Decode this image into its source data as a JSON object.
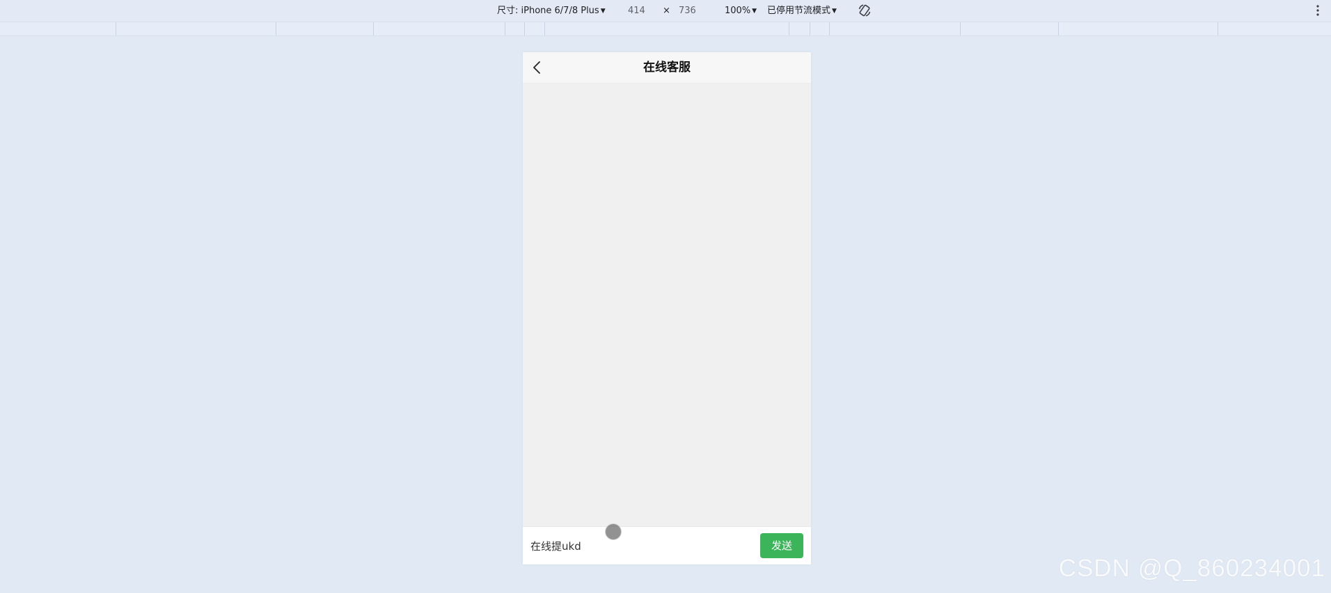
{
  "devtools": {
    "device_label": "尺寸: iPhone 6/7/8 Plus",
    "width": "414",
    "times": "×",
    "height": "736",
    "zoom": "100%",
    "throttle": "已停用节流模式",
    "rotate_icon": "rotate-icon",
    "more_icon": "more-vertical-icon"
  },
  "page": {
    "back_icon": "chevron-left-icon",
    "title": "在线客服"
  },
  "input": {
    "value": "在线提ukd"
  },
  "send_label": "发送",
  "watermark": "CSDN @Q_860234001",
  "colors": {
    "send_button": "#3cb55a",
    "chat_background": "#f0f0f0",
    "navbar_background": "#f7f7f7",
    "page_background": "#dfe8f5"
  }
}
